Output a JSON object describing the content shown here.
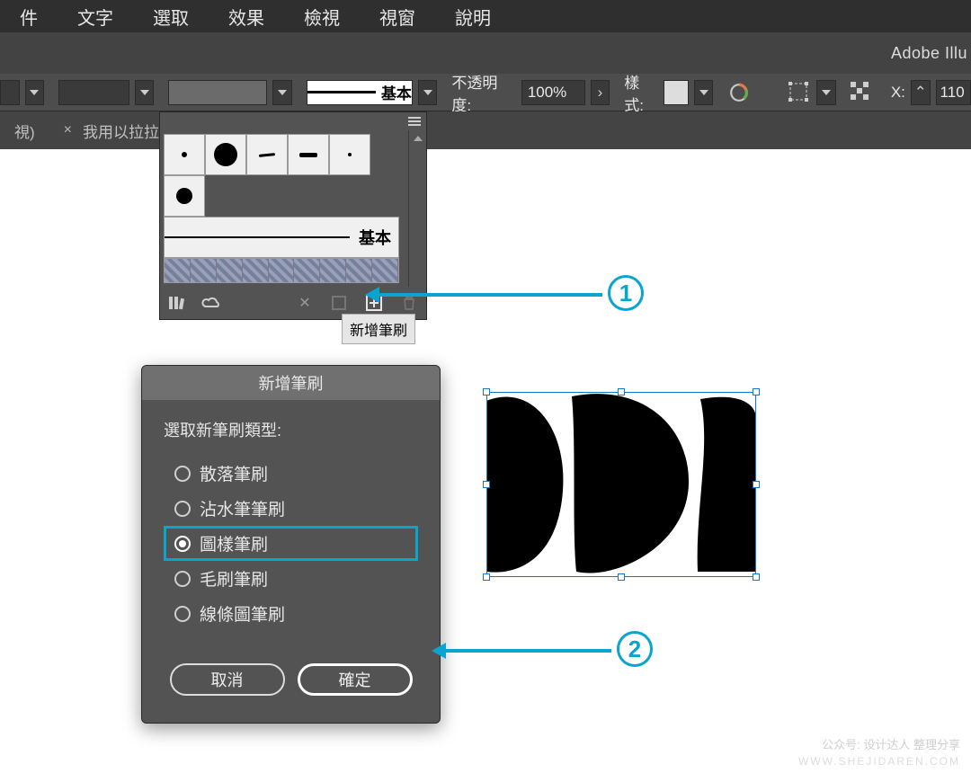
{
  "menu": {
    "items": [
      "件",
      "文字",
      "選取",
      "效果",
      "檢視",
      "視窗",
      "說明"
    ]
  },
  "app_title": "Adobe Illu",
  "options": {
    "stroke_preset": "基本",
    "opacity_label": "不透明度:",
    "opacity_value": "100%",
    "style_label": "樣式:",
    "x_label": "X:",
    "x_value": "110"
  },
  "tabs": {
    "t1": "視)",
    "t2": "我用以拉拉的."
  },
  "brushes_panel": {
    "row_label": "基本",
    "tooltip": "新增筆刷"
  },
  "dialog": {
    "title": "新增筆刷",
    "heading": "選取新筆刷類型:",
    "options": {
      "o1": "散落筆刷",
      "o2": "沾水筆筆刷",
      "o3": "圖樣筆刷",
      "o4": "毛刷筆刷",
      "o5": "線條圖筆刷"
    },
    "cancel": "取消",
    "ok": "確定"
  },
  "annotations": {
    "a1": "1",
    "a2": "2"
  },
  "watermark": {
    "line1": "公众号: 设计达人 整理分享",
    "line2": "WWW.SHEJIDAREN.COM"
  }
}
